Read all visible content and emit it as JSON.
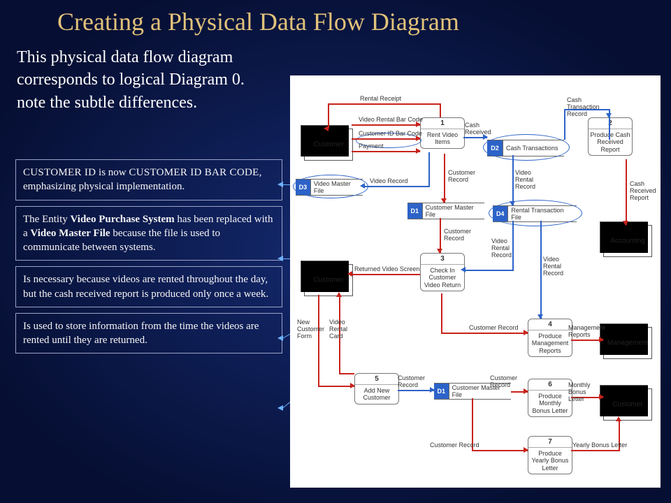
{
  "title": "Creating a Physical Data Flow Diagram",
  "intro": "This  physical data flow diagram corresponds to logical Diagram 0. note the subtle differences.",
  "notes": {
    "n1_a": "CUSTOMER ID",
    "n1_b": " is now ",
    "n1_c": "CUSTOMER ID BAR CODE",
    "n1_d": ", emphasizing physical implementation.",
    "n2_a": "The Entity ",
    "n2_b": "Video Purchase System",
    "n2_c": " has been replaced with a ",
    "n2_d": "Video Master File",
    "n2_e": " because the file is used to communicate between systems.",
    "n3": "Is necessary because videos are rented throughout the day, but the cash received report is produced only once a week.",
    "n4": "Is used to store information from the time the videos are rented until they are returned."
  },
  "entities": {
    "cust1": "Customer",
    "cust2": "Customer",
    "acct": "Accounting",
    "mgmt": "Management",
    "cust3": "Customer"
  },
  "processes": {
    "p1n": "1",
    "p1": "Rent Video Items",
    "p2n": "2",
    "p2": "Produce Cash Received Report",
    "p3n": "3",
    "p3": "Check In Customer Video Return",
    "p4n": "4",
    "p4": "Produce Management Reports",
    "p5n": "5",
    "p5": "Add New Customer",
    "p6n": "6",
    "p6": "Produce Monthly Bonus Letter",
    "p7n": "7",
    "p7": "Produce Yearly Bonus Letter"
  },
  "stores": {
    "d1": "D1",
    "d1t": "Customer Master File",
    "d1b": "D1",
    "d1bt": "Customer Master File",
    "d2": "D2",
    "d2t": "Cash Transactions",
    "d3": "D3",
    "d3t": "Video Master File",
    "d4": "D4",
    "d4t": "Rental Transaction File"
  },
  "flows": {
    "f_rentalReceipt": "Rental Receipt",
    "f_videoBarcode": "Video Rental Bar Code",
    "f_custBarcode": "Customer ID Bar Code",
    "f_payment": "Payment",
    "f_cashRecv": "Cash Received",
    "f_cashTrans": "Cash Transaction Record",
    "f_videoRec": "Video Record",
    "f_custRec": "Customer Record",
    "f_vrRec": "Video Rental Record",
    "f_cashRep": "Cash Received Report",
    "f_retScreen": "Returned Video Screen",
    "f_newCustForm": "New Customer Form",
    "f_vrCard": "Video Rental Card",
    "f_mgmtRep": "Management Reports",
    "f_monthly": "Monthly Bonus Letter",
    "f_yearly": "Yearly Bonus Letter"
  }
}
